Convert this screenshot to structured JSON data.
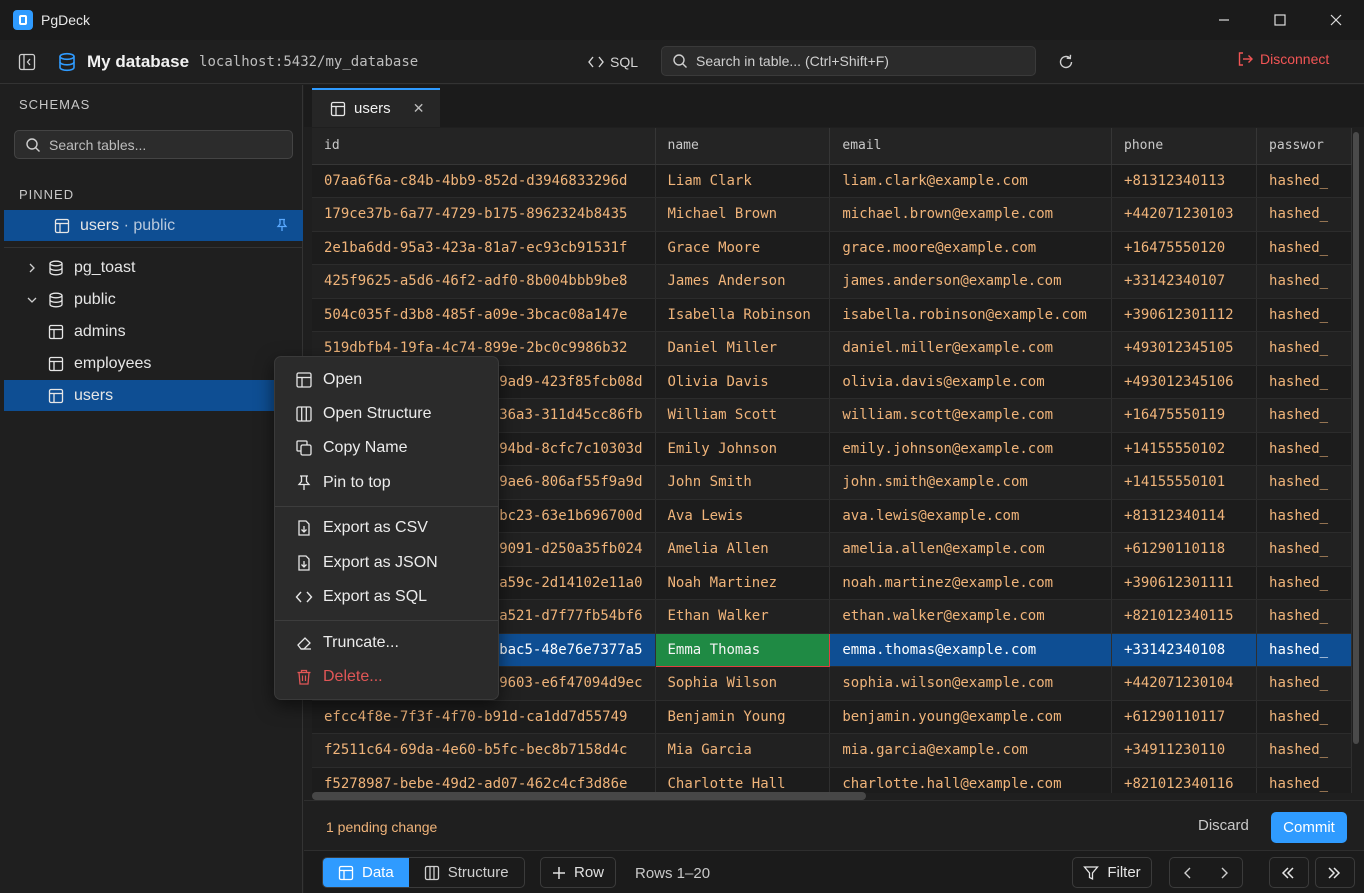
{
  "app": {
    "title": "PgDeck"
  },
  "toolbar": {
    "db_name": "My database",
    "db_host": "localhost:5432/my_database",
    "sql_label": "SQL",
    "search_placeholder": "Search in table... (Ctrl+Shift+F)",
    "disconnect_label": "Disconnect"
  },
  "sidebar": {
    "schemas_heading": "SCHEMAS",
    "search_placeholder": "Search tables...",
    "pinned_heading": "PINNED",
    "pinned": [
      {
        "label": "users",
        "schema": " · public"
      }
    ],
    "tree": [
      {
        "label": "pg_toast",
        "type": "schema",
        "expanded": false
      },
      {
        "label": "public",
        "type": "schema",
        "expanded": true
      },
      {
        "label": "admins",
        "type": "table"
      },
      {
        "label": "employees",
        "type": "table"
      },
      {
        "label": "users",
        "type": "table",
        "selected": true
      }
    ]
  },
  "tab": {
    "label": "users"
  },
  "grid": {
    "columns": [
      "id",
      "name",
      "email",
      "phone",
      "passwor"
    ],
    "rows": [
      [
        "07aa6f6a-c84b-4bb9-852d-d3946833296d",
        "Liam Clark",
        "liam.clark@example.com",
        "+81312340113",
        "hashed_"
      ],
      [
        "179ce37b-6a77-4729-b175-8962324b8435",
        "Michael Brown",
        "michael.brown@example.com",
        "+442071230103",
        "hashed_"
      ],
      [
        "2e1ba6dd-95a3-423a-81a7-ec93cb91531f",
        "Grace Moore",
        "grace.moore@example.com",
        "+16475550120",
        "hashed_"
      ],
      [
        "425f9625-a5d6-46f2-adf0-8b004bbb9be8",
        "James Anderson",
        "james.anderson@example.com",
        "+33142340107",
        "hashed_"
      ],
      [
        "504c035f-d3b8-485f-a09e-3bcac08a147e",
        "Isabella Robinson",
        "isabella.robinson@example.com",
        "+390612301112",
        "hashed_"
      ],
      [
        "519dbfb4-19fa-4c74-899e-2bc0c9986b32",
        "Daniel Miller",
        "daniel.miller@example.com",
        "+493012345105",
        "hashed_"
      ],
      [
        "9ad9-423f85fcb08d",
        "Olivia Davis",
        "olivia.davis@example.com",
        "+493012345106",
        "hashed_"
      ],
      [
        "36a3-311d45cc86fb",
        "William Scott",
        "william.scott@example.com",
        "+16475550119",
        "hashed_"
      ],
      [
        "94bd-8cfc7c10303d",
        "Emily Johnson",
        "emily.johnson@example.com",
        "+14155550102",
        "hashed_"
      ],
      [
        "9ae6-806af55f9a9d",
        "John Smith",
        "john.smith@example.com",
        "+14155550101",
        "hashed_"
      ],
      [
        "bc23-63e1b696700d",
        "Ava Lewis",
        "ava.lewis@example.com",
        "+81312340114",
        "hashed_"
      ],
      [
        "9091-d250a35fb024",
        "Amelia Allen",
        "amelia.allen@example.com",
        "+61290110118",
        "hashed_"
      ],
      [
        "a59c-2d14102e11a0",
        "Noah Martinez",
        "noah.martinez@example.com",
        "+390612301111",
        "hashed_"
      ],
      [
        "a521-d7f77fb54bf6",
        "Ethan Walker",
        "ethan.walker@example.com",
        "+821012340115",
        "hashed_"
      ],
      [
        "bac5-48e76e7377a5",
        "Emma Thomas",
        "emma.thomas@example.com",
        "+33142340108",
        "hashed_"
      ],
      [
        "9603-e6f47094d9ec",
        "Sophia Wilson",
        "sophia.wilson@example.com",
        "+442071230104",
        "hashed_"
      ],
      [
        "efcc4f8e-7f3f-4f70-b91d-ca1dd7d55749",
        "Benjamin Young",
        "benjamin.young@example.com",
        "+61290110117",
        "hashed_"
      ],
      [
        "f2511c64-69da-4e60-b5fc-bec8b7158d4c",
        "Mia Garcia",
        "mia.garcia@example.com",
        "+34911230110",
        "hashed_"
      ],
      [
        "f5278987-bebe-49d2-ad07-462c4cf3d86e",
        "Charlotte Hall",
        "charlotte.hall@example.com",
        "+821012340116",
        "hashed_"
      ]
    ],
    "selected_row": 14,
    "edited_cell": {
      "row": 14,
      "col": 1
    }
  },
  "pending": {
    "text": "1 pending change",
    "discard_label": "Discard",
    "commit_label": "Commit"
  },
  "footer": {
    "data_label": "Data",
    "structure_label": "Structure",
    "row_label": "Row",
    "rows_text": "Rows 1–20",
    "filter_label": "Filter"
  },
  "context_menu": {
    "items": [
      {
        "label": "Open",
        "icon": "table-icon"
      },
      {
        "label": "Open Structure",
        "icon": "columns-icon"
      },
      {
        "label": "Copy Name",
        "icon": "copy-icon"
      },
      {
        "label": "Pin to top",
        "icon": "pin-icon"
      },
      {
        "label": "Export as CSV",
        "icon": "file-export-icon"
      },
      {
        "label": "Export as JSON",
        "icon": "file-export-icon"
      },
      {
        "label": "Export as SQL",
        "icon": "code-icon"
      },
      {
        "label": "Truncate...",
        "icon": "eraser-icon"
      },
      {
        "label": "Delete...",
        "icon": "trash-icon",
        "danger": true
      }
    ]
  },
  "colors": {
    "accent": "#2f9bff",
    "selection": "#0e4e93",
    "edited": "#1f8a44",
    "danger": "#e05656",
    "cell_text": "#f0b47a"
  }
}
